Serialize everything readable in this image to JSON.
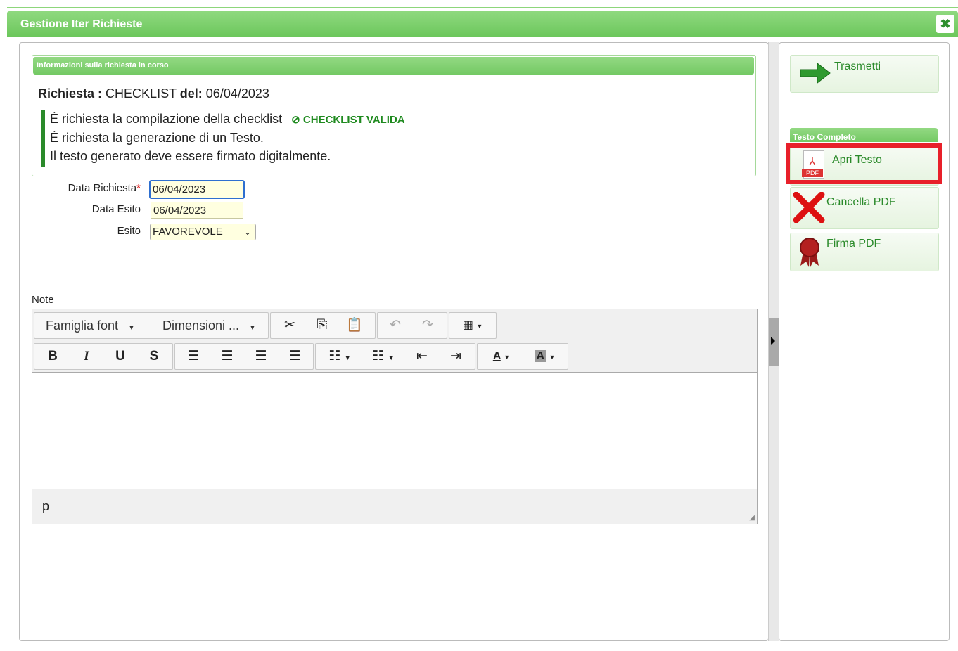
{
  "window": {
    "title": "Gestione Iter Richieste",
    "close_glyph": "✖"
  },
  "info": {
    "header": "Informazioni sulla richiesta in corso",
    "richiesta_label": "Richiesta :",
    "richiesta_value": "CHECKLIST",
    "del_label": "del:",
    "del_value": "06/04/2023",
    "lines": [
      "È richiesta la compilazione della checklist",
      "È richiesta la generazione di un Testo.",
      "Il testo generato deve essere firmato digitalmente."
    ],
    "valid_badge": "CHECKLIST VALIDA"
  },
  "form": {
    "data_richiesta_label": "Data Richiesta",
    "data_richiesta_value": "06/04/2023",
    "data_esito_label": "Data Esito",
    "data_esito_value": "06/04/2023",
    "esito_label": "Esito",
    "esito_value": "FAVOREVOLE",
    "required_mark": "*"
  },
  "note": {
    "label": "Note",
    "font_family_dropdown": "Famiglia font",
    "font_size_dropdown": "Dimensioni ...",
    "status_path": "p"
  },
  "actions": {
    "trasmetti": "Trasmetti",
    "section_title": "Testo Completo",
    "apri_testo": "Apri Testo",
    "cancella_pdf": "Cancella PDF",
    "firma_pdf": "Firma PDF",
    "pdf_badge": "PDF"
  },
  "colors": {
    "accent_green": "#74c964",
    "highlight_red": "#e8202a",
    "link_green": "#2a8a2a"
  }
}
